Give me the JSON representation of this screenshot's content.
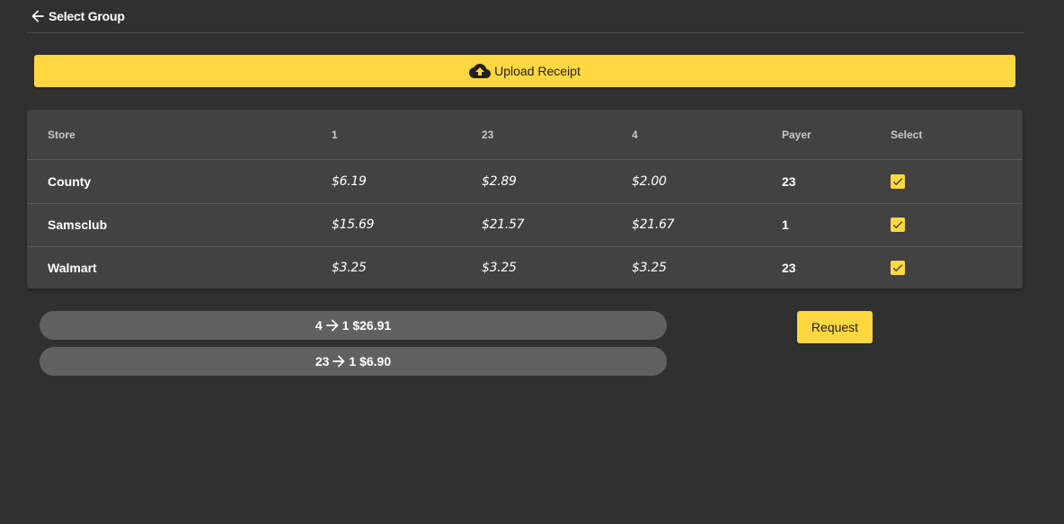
{
  "header": {
    "back_icon": "arrow-left-icon",
    "title": "Select Group"
  },
  "upload": {
    "icon": "cloud-upload-icon",
    "label": "Upload Receipt"
  },
  "table": {
    "headers": [
      "Store",
      "1",
      "23",
      "4",
      "Payer",
      "Select"
    ],
    "rows": [
      {
        "store": "County",
        "a": "$6.19",
        "b": "$2.89",
        "c": "$2.00",
        "payer": "23",
        "selected": true
      },
      {
        "store": "Samsclub",
        "a": "$15.69",
        "b": "$21.57",
        "c": "$21.67",
        "payer": "1",
        "selected": true
      },
      {
        "store": "Walmart",
        "a": "$3.25",
        "b": "$3.25",
        "c": "$3.25",
        "payer": "23",
        "selected": true
      }
    ]
  },
  "settlements": [
    {
      "from": "4",
      "to": "1 $26.91",
      "icon": "arrow-right-icon"
    },
    {
      "from": "23",
      "to": "1 $6.90",
      "icon": "arrow-right-icon"
    }
  ],
  "request_button": {
    "label": "Request"
  },
  "colors": {
    "background": "#303030",
    "card": "#424242",
    "accent": "#ffd740",
    "pill": "#616161"
  }
}
